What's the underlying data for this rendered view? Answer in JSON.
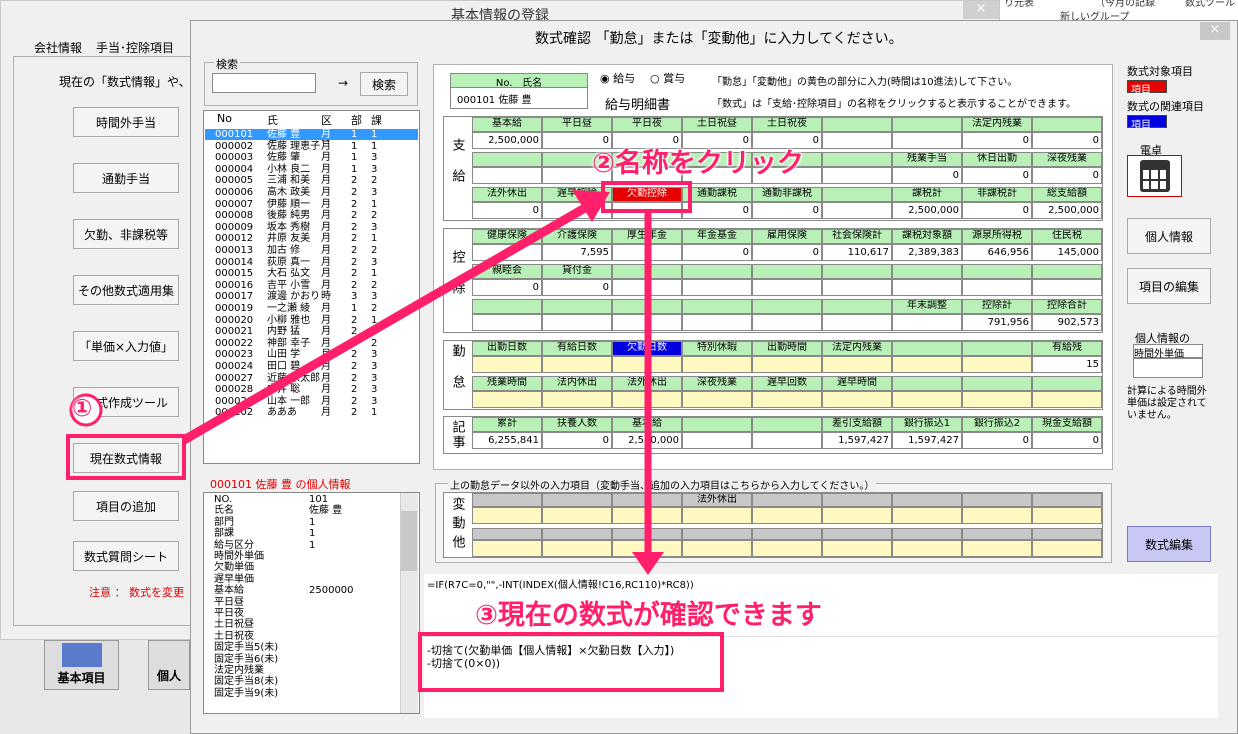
{
  "bg": {
    "title": "基本情報の登録",
    "tabs": [
      "会社情報",
      "手当･控除項目"
    ],
    "desc": "現在の「数式情報」や、オリ",
    "buttons": [
      "時間外手当",
      "通勤手当",
      "欠勤、非課税等",
      "その他数式適用集",
      "「単価×入力値」",
      "数式作成ツール",
      "現在数式情報",
      "項目の追加",
      "数式質問シート"
    ],
    "note": "注意 ： 数式を変更",
    "bottom_icons": [
      "基本項目",
      "個人"
    ],
    "right_top": [
      "り元表",
      "（今月の記録",
      "数式ツール",
      "新しいグループ"
    ]
  },
  "dlg": {
    "title": "数式確認 「勤怠」または「変動他」に入力してください。",
    "close": "×",
    "search_label": "検索",
    "search_value": "",
    "arrow": "→",
    "search_btn": "検索",
    "col_headers": [
      "No",
      "氏名",
      "区分",
      "部",
      "課"
    ],
    "employees": [
      [
        "000101",
        "佐藤 豊",
        "月",
        "1",
        "1"
      ],
      [
        "000002",
        "佐藤 理恵子",
        "月",
        "1",
        "1"
      ],
      [
        "000003",
        "佐藤 肇",
        "月",
        "1",
        "3"
      ],
      [
        "000004",
        "小林 良二",
        "月",
        "1",
        "3"
      ],
      [
        "000005",
        "三浦 和美",
        "月",
        "2",
        "2"
      ],
      [
        "000006",
        "高木 政美",
        "月",
        "2",
        "3"
      ],
      [
        "000007",
        "伊藤 順一",
        "月",
        "2",
        "1"
      ],
      [
        "000008",
        "後藤 純男",
        "月",
        "2",
        "2"
      ],
      [
        "000009",
        "坂本 秀樹",
        "月",
        "2",
        "3"
      ],
      [
        "000012",
        "井原 友美",
        "月",
        "2",
        "1"
      ],
      [
        "000013",
        "加古 修",
        "月",
        "2",
        "2"
      ],
      [
        "000014",
        "荻原 真一",
        "月",
        "2",
        "3"
      ],
      [
        "000015",
        "大石 弘文",
        "月",
        "2",
        "1"
      ],
      [
        "000016",
        "吉平 小雪",
        "月",
        "2",
        "2"
      ],
      [
        "000017",
        "渡邊 かおり",
        "時",
        "3",
        "3"
      ],
      [
        "000019",
        "一之瀬 綾",
        "月",
        "1",
        "2"
      ],
      [
        "000020",
        "小柳 雅也",
        "月",
        "2",
        "1"
      ],
      [
        "000021",
        "内野 猛",
        "月",
        "2",
        "1"
      ],
      [
        "000022",
        "神部 幸子",
        "月",
        "3",
        "2"
      ],
      [
        "000023",
        "山田 学",
        "月",
        "2",
        "3"
      ],
      [
        "000024",
        "田口 碧",
        "月",
        "2",
        "3"
      ],
      [
        "000027",
        "近藤 宗太郎",
        "月",
        "2",
        "3"
      ],
      [
        "000028",
        "中井 聡",
        "月",
        "2",
        "3"
      ],
      [
        "000029",
        "山本 一郎",
        "月",
        "2",
        "3"
      ],
      [
        "000102",
        "あああ",
        "月",
        "2",
        "1"
      ]
    ],
    "personal_title": "000101 佐藤 豊 の個人情報",
    "personal": [
      [
        "NO.",
        "101"
      ],
      [
        "氏名",
        "佐藤 豊"
      ],
      [
        "部門",
        "1"
      ],
      [
        "部課",
        "1"
      ],
      [
        "給与区分",
        "1"
      ],
      [
        "時間外単価",
        ""
      ],
      [
        "欠勤単価",
        ""
      ],
      [
        "遅早単価",
        ""
      ],
      [
        "基本給",
        "2500000"
      ],
      [
        "平日昼",
        ""
      ],
      [
        "平日夜",
        ""
      ],
      [
        "土日祝昼",
        ""
      ],
      [
        "土日祝夜",
        ""
      ],
      [
        "固定手当5(未)",
        ""
      ],
      [
        "固定手当6(未)",
        ""
      ],
      [
        "法定内残業",
        ""
      ],
      [
        "固定手当8(未)",
        ""
      ],
      [
        "固定手当9(未)",
        ""
      ]
    ],
    "emp_box_no": "No.",
    "emp_box_name": "氏名",
    "emp_box_val": "000101 佐藤 豊",
    "radio": [
      "給与",
      "賞与"
    ],
    "slip_title": "給与明細書",
    "instr": [
      "「勤怠」「変動他」の黄色の部分に入力(時間は10進法)して下さい。",
      "「数式」は「支給･控除項目」の名称をクリックすると表示することができます。"
    ],
    "sections": {
      "shikyu": "支給",
      "kojo": "控除",
      "kintai": "勤怠",
      "kiji": "記事",
      "hendo": "変動他"
    },
    "shikyu_r1_h": [
      "基本給",
      "平日昼",
      "平日夜",
      "土日祝昼",
      "土日祝夜",
      "",
      "",
      "法定内残業",
      ""
    ],
    "shikyu_r1_v": [
      "2,500,000",
      "0",
      "0",
      "0",
      "0",
      "",
      "",
      "0",
      "0"
    ],
    "shikyu_r2_h": [
      "",
      "",
      "",
      "",
      "",
      "",
      "残業手当",
      "休日出勤",
      "深夜残業"
    ],
    "shikyu_r2_v": [
      "",
      "",
      "",
      "",
      "",
      "",
      "0",
      "0",
      "0"
    ],
    "shikyu_r3_h": [
      "法外休出",
      "遅早控除",
      "欠勤控除",
      "通勤課税",
      "通勤非課税",
      "",
      "課税計",
      "非課税計",
      "総支給額"
    ],
    "shikyu_r3_v": [
      "0",
      "",
      "",
      "0",
      "0",
      "",
      "2,500,000",
      "0",
      "2,500,000"
    ],
    "kojo_r1_h": [
      "健康保険",
      "介護保険",
      "厚生年金",
      "年金基金",
      "雇用保険",
      "社会保険計",
      "課税対象額",
      "源泉所得税",
      "住民税"
    ],
    "kojo_r1_v": [
      "",
      "7,595",
      "",
      "0",
      "0",
      "110,617",
      "2,389,383",
      "646,956",
      "145,000"
    ],
    "kojo_r2_h": [
      "親睦会",
      "貸付金",
      "",
      "",
      "",
      "",
      "",
      "",
      ""
    ],
    "kojo_r2_v": [
      "0",
      "0",
      "",
      "",
      "",
      "",
      "",
      "",
      ""
    ],
    "kojo_r3_h": [
      "",
      "",
      "",
      "",
      "",
      "",
      "年末調整",
      "控除計",
      "控除合計"
    ],
    "kojo_r3_v": [
      "",
      "",
      "",
      "",
      "",
      "",
      "",
      "791,956",
      "902,573"
    ],
    "kin_r1_h": [
      "出勤日数",
      "有給日数",
      "欠勤日数",
      "特別休暇",
      "出勤時間",
      "法定内残業",
      "",
      "",
      "有給残"
    ],
    "kin_r1_v": [
      "",
      "",
      "",
      "",
      "",
      "",
      "",
      "",
      "15"
    ],
    "kin_r2_h": [
      "残業時間",
      "法内休出",
      "法外休出",
      "深夜残業",
      "遅早回数",
      "遅早時間",
      "",
      "",
      ""
    ],
    "kin_r2_v": [
      "",
      "",
      "",
      "",
      "",
      "",
      "",
      "",
      ""
    ],
    "kiji_h": [
      "累計",
      "扶養人数",
      "基本給",
      "",
      "",
      "差引支給額",
      "銀行振込1",
      "銀行振込2",
      "現金支給額"
    ],
    "kiji_v": [
      "6,255,841",
      "0",
      "2,500,000",
      "",
      "",
      "1,597,427",
      "1,597,427",
      "0",
      "0"
    ],
    "hendo_title": "上の勤怠データ以外の入力項目（変動手当、追加の入力項目はこちらから入力してください。）",
    "hendo_h": [
      "",
      "",
      "",
      "法外休出",
      "",
      "",
      "",
      "",
      "",
      ""
    ],
    "right_lbl1": "数式対象項目",
    "right_box1": "項目",
    "right_lbl2": "数式の関連項目",
    "right_box2": "項目",
    "calc": "電卓",
    "btn_personal": "個人情報",
    "btn_items": "項目の編集",
    "rinfo1": "個人情報の",
    "rinfo2": "時間外単価",
    "rnote": "計算による時間外単価は設定されていません。",
    "btn_formula": "数式編集",
    "formula": "=IF(R7C=0,\"\",-INT(INDEX(個人情報!C16,RC110)*RC8))",
    "explain": [
      "-切捨て(欠勤単価【個人情報】×欠勤日数【入力】)",
      "-切捨て(0×0))"
    ]
  },
  "annotations": {
    "a1": "①",
    "a2": "②名称をクリック",
    "a3": "③現在の数式が確認できます"
  },
  "colors": {
    "accent": "#ff1f6b",
    "header_green": "#b8f0b8",
    "selected_red": "#e60000",
    "selected_blue": "#0000e0",
    "field_yellow": "#fff8c0"
  }
}
